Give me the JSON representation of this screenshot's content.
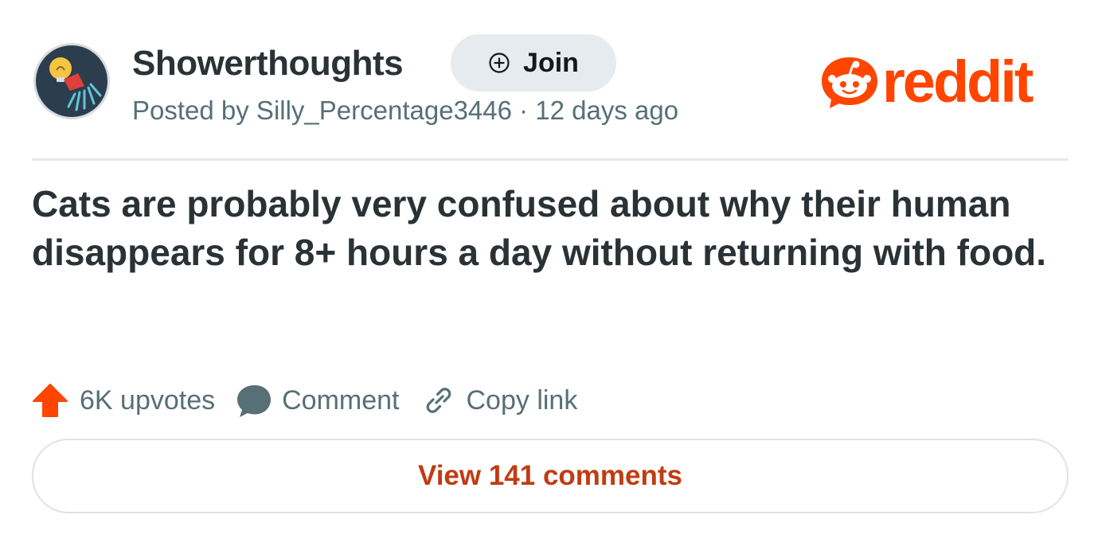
{
  "post": {
    "subreddit": "Showerthoughts",
    "join_label": "Join",
    "meta": "Posted by Silly_Percentage3446 · 12 days ago",
    "title": "Cats are probably very confused about why their human disappears for 8+ hours a day without returning with food.",
    "upvotes_label": "6K upvotes",
    "comment_label": "Comment",
    "copy_link_label": "Copy link",
    "view_comments_label": "View 141 comments"
  },
  "brand": {
    "logo_text": "reddit",
    "accent_color": "#ff4500",
    "link_color": "#c13b12"
  },
  "icons": {
    "subreddit_avatar": "lightbulb-shower-icon",
    "join": "plus-circle-icon",
    "logo": "reddit-snoo-icon",
    "upvote": "upvote-arrow-icon",
    "comment": "comment-bubble-icon",
    "copy_link": "link-icon"
  }
}
